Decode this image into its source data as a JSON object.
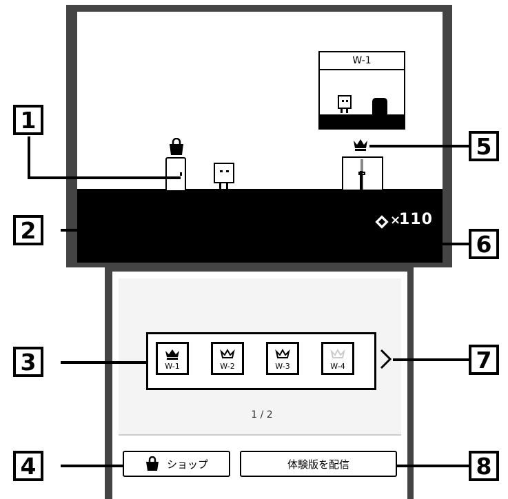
{
  "callouts": [
    "1",
    "2",
    "3",
    "4",
    "5",
    "6",
    "7",
    "8"
  ],
  "preview": {
    "title": "W-1"
  },
  "score": {
    "symbol": "×",
    "value": "110"
  },
  "worlds": [
    {
      "label": "W-1",
      "state": "crown-filled"
    },
    {
      "label": "W-2",
      "state": "crown-outline"
    },
    {
      "label": "W-3",
      "state": "crown-outline"
    },
    {
      "label": "W-4",
      "state": "crown-faint"
    }
  ],
  "pagination": "1 / 2",
  "shop_button": {
    "label": "ショップ",
    "icon": "shopping-bag-icon"
  },
  "demo_button": {
    "label": "体験版を配信"
  },
  "next_arrow": {
    "icon": "chevron-right-icon"
  }
}
